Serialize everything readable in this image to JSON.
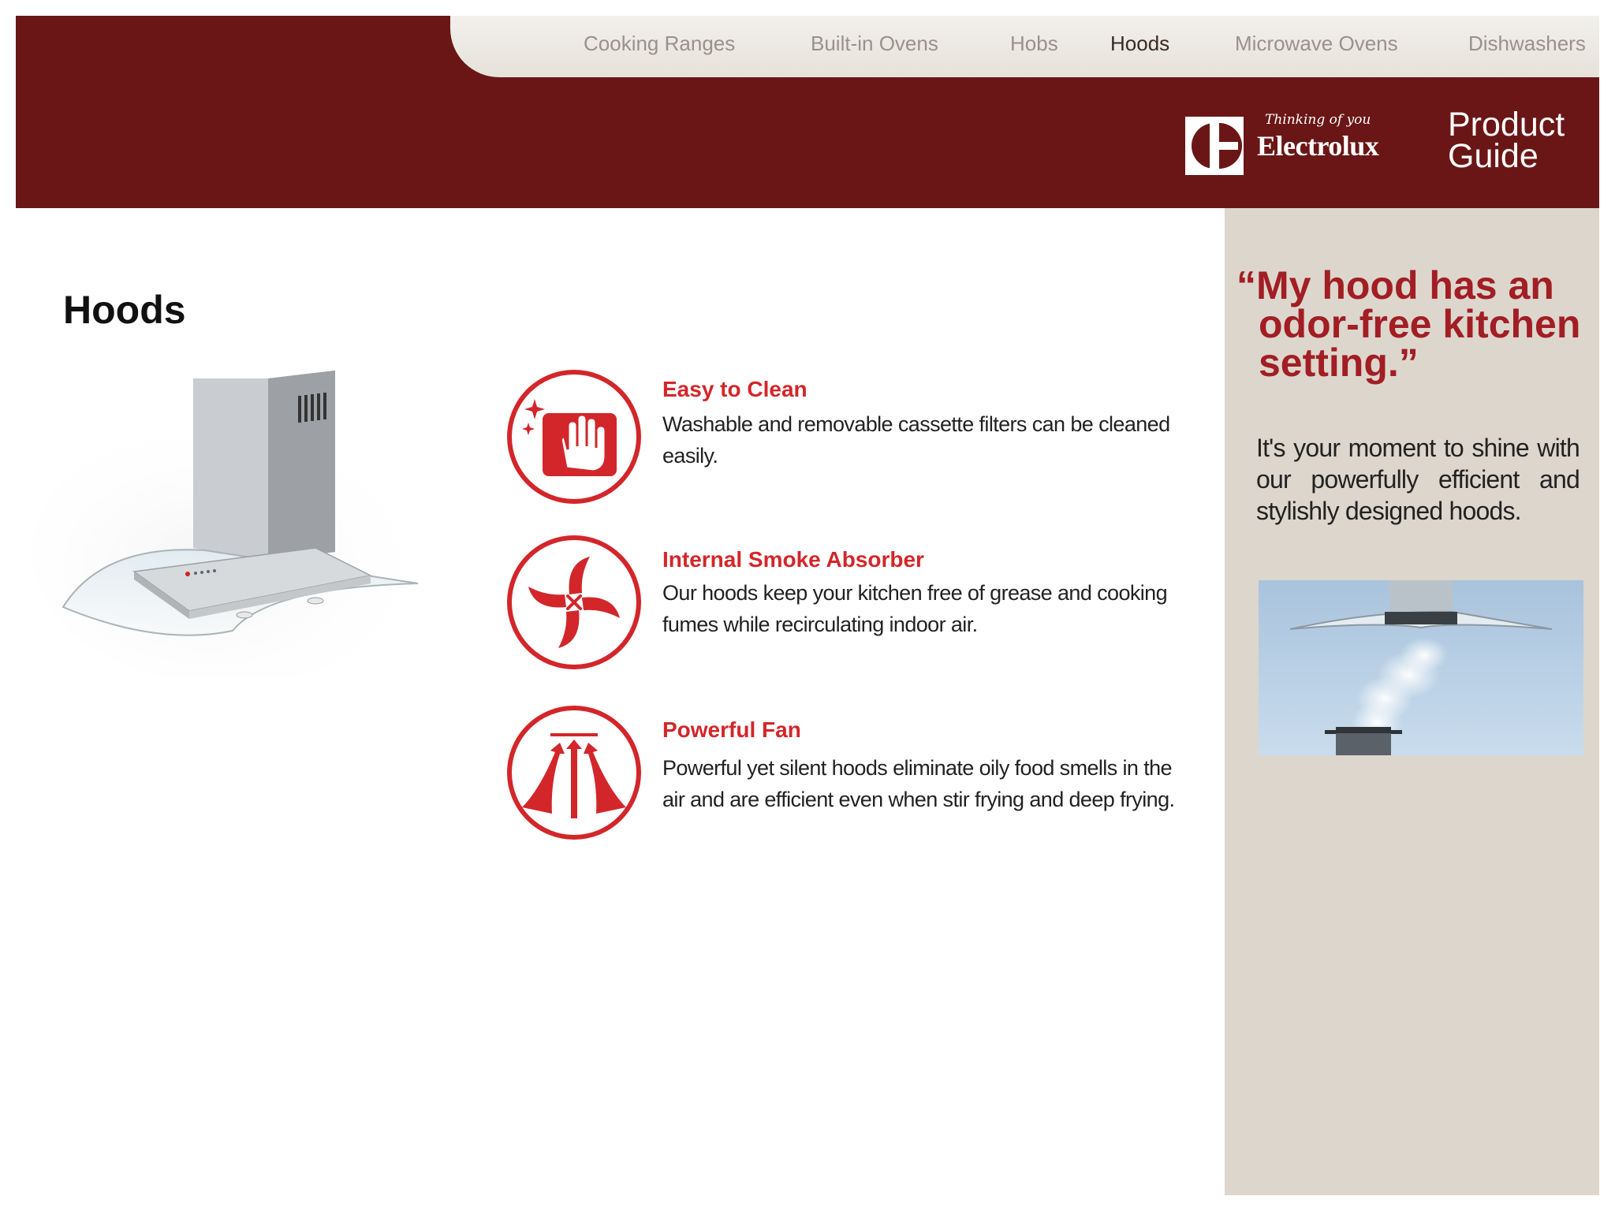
{
  "nav": {
    "items": [
      {
        "label": "Cooking Ranges",
        "active": false
      },
      {
        "label": "Built-in Ovens",
        "active": false
      },
      {
        "label": "Hobs",
        "active": false
      },
      {
        "label": "Hoods",
        "active": true
      },
      {
        "label": "Microwave Ovens",
        "active": false
      },
      {
        "label": "Dishwashers",
        "active": false
      }
    ]
  },
  "brand": {
    "tagline": "Thinking of you",
    "name": "Electrolux",
    "guide_line1": "Product",
    "guide_line2": "Guide"
  },
  "page": {
    "title": "Hoods"
  },
  "features": [
    {
      "icon": "easy-clean-icon",
      "title": "Easy to Clean",
      "desc": "Washable and removable cassette filters can be cleaned easily."
    },
    {
      "icon": "smoke-absorber-icon",
      "title": "Internal Smoke Absorber",
      "desc": "Our hoods keep your kitchen free of grease and cooking fumes while recirculating indoor air."
    },
    {
      "icon": "powerful-fan-icon",
      "title": "Powerful Fan",
      "desc": "Powerful yet silent hoods eliminate oily food smells in the air and are efficient even when stir frying and deep frying."
    }
  ],
  "side": {
    "quote_line1": "“My hood has an",
    "quote_line2": "odor-free kitchen",
    "quote_line3": "setting.”",
    "text": "It's your moment to shine with our powerfully efficient and stylishly designed hoods."
  },
  "colors": {
    "header_bg": "#6b1616",
    "accent_red": "#d3262a",
    "quote_red": "#a11e24",
    "side_panel_bg": "#ddd6cc",
    "nav_text": "#9a9189",
    "nav_active": "#3b2a22"
  }
}
